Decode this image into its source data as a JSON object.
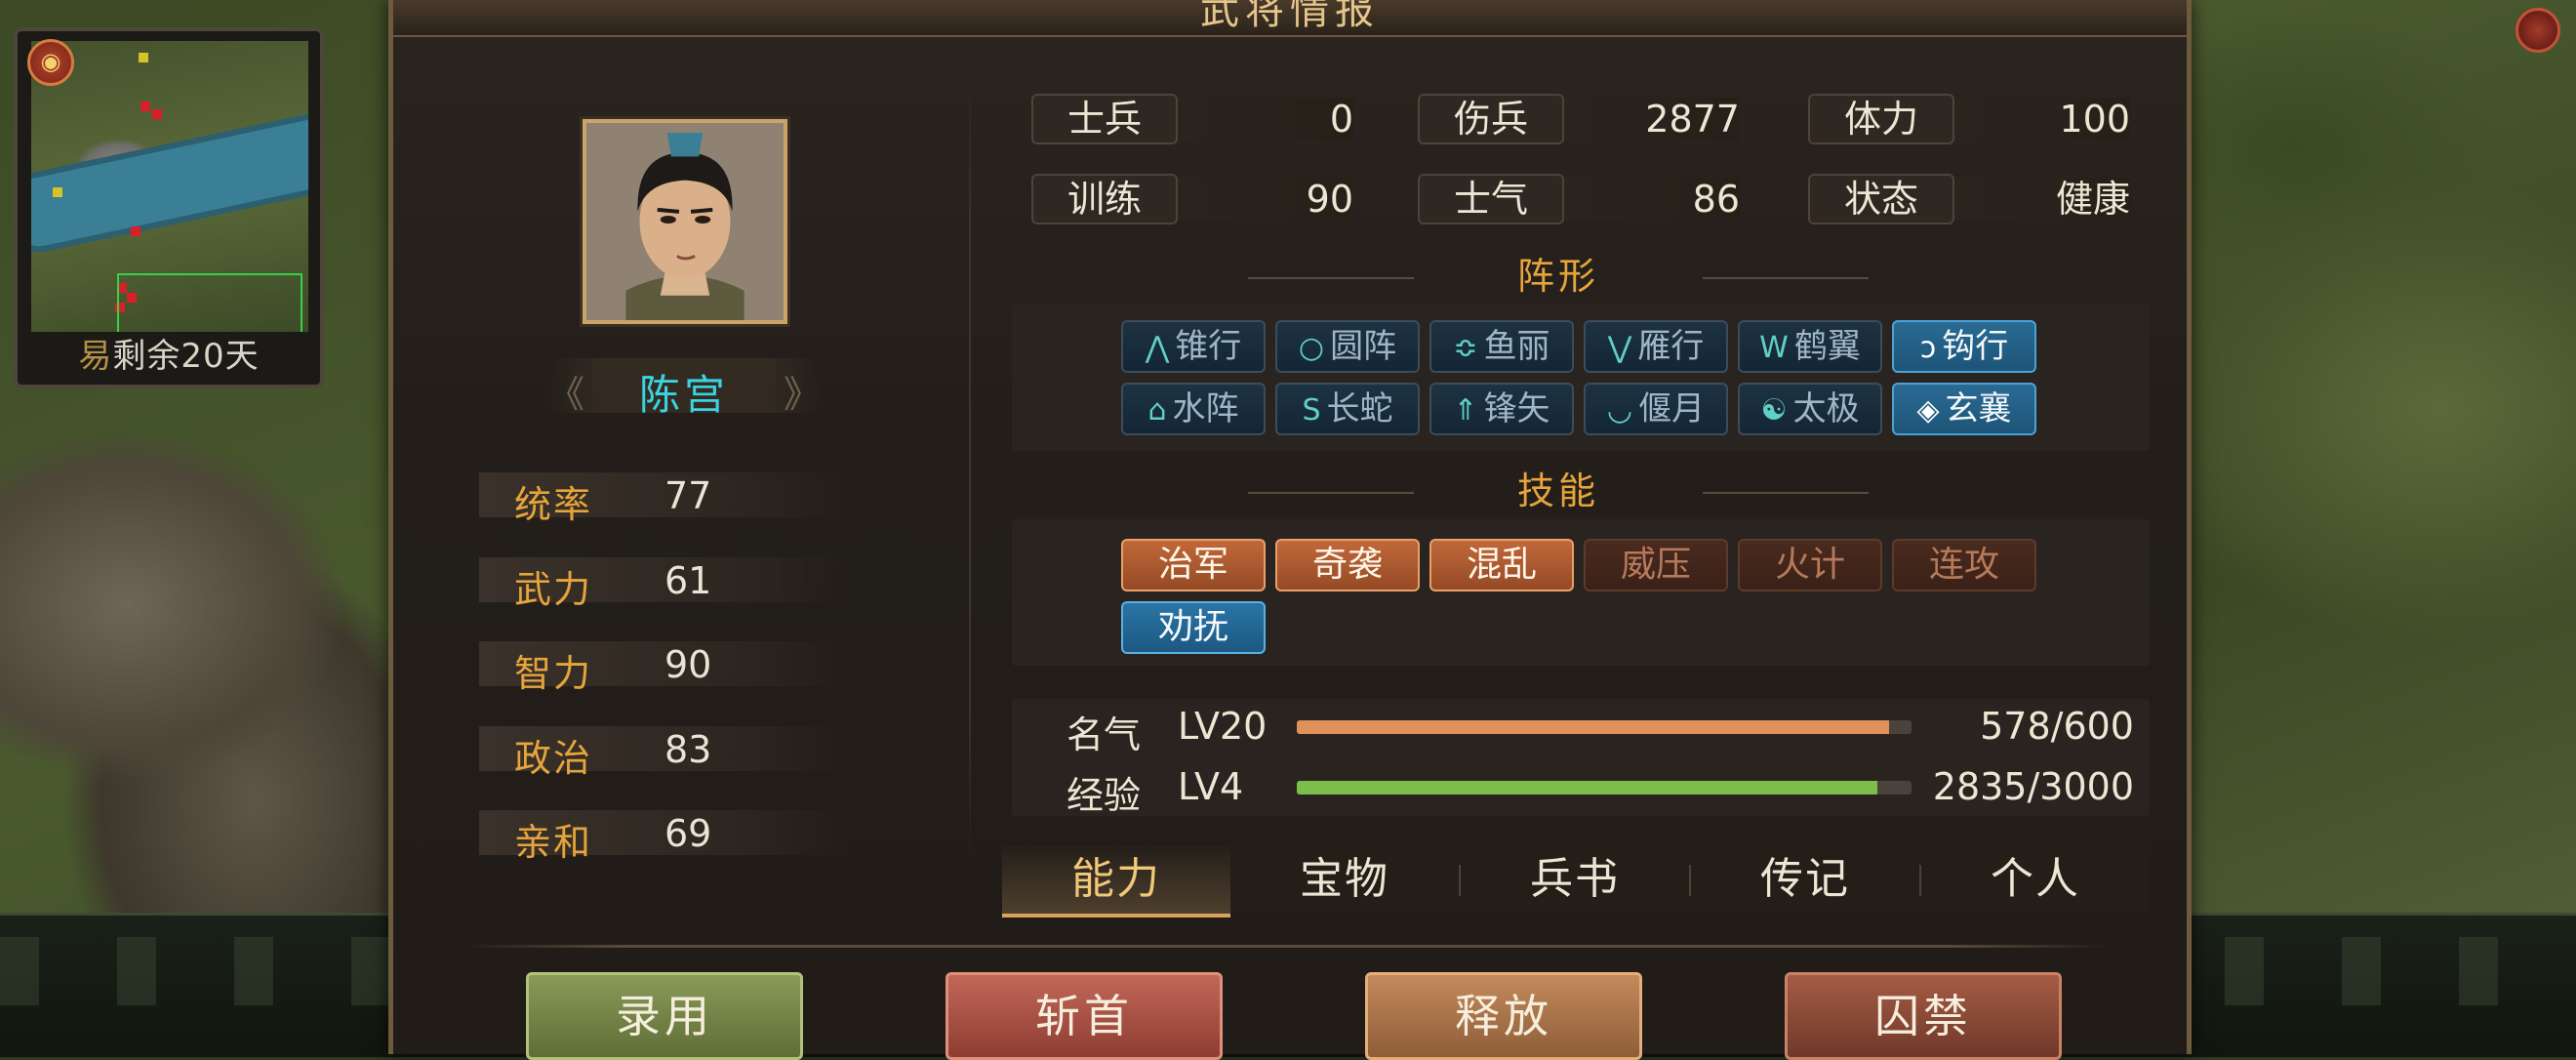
{
  "window": {
    "title": "武将情报"
  },
  "minimap": {
    "mark": "易",
    "caption": "剩余20天"
  },
  "general": {
    "name": "陈宫"
  },
  "attributes": [
    {
      "label": "统率",
      "value": "77"
    },
    {
      "label": "武力",
      "value": "61"
    },
    {
      "label": "智力",
      "value": "90"
    },
    {
      "label": "政治",
      "value": "83"
    },
    {
      "label": "亲和",
      "value": "69"
    }
  ],
  "stats": [
    {
      "label": "士兵",
      "value": "0"
    },
    {
      "label": "伤兵",
      "value": "2877"
    },
    {
      "label": "体力",
      "value": "100"
    },
    {
      "label": "训练",
      "value": "90"
    },
    {
      "label": "士气",
      "value": "86"
    },
    {
      "label": "状态",
      "value": "健康"
    }
  ],
  "formation": {
    "title": "阵形",
    "items": [
      {
        "label": "锥行",
        "icon": "⋀",
        "icon_name": "arrowhead-icon",
        "active": false
      },
      {
        "label": "圆阵",
        "icon": "○",
        "icon_name": "circle-icon",
        "active": false
      },
      {
        "label": "鱼丽",
        "icon": "≎",
        "icon_name": "fish-scale-icon",
        "active": false
      },
      {
        "label": "雁行",
        "icon": "⋁",
        "icon_name": "v-shape-icon",
        "active": false
      },
      {
        "label": "鹤翼",
        "icon": "W",
        "icon_name": "crane-wing-icon",
        "active": false
      },
      {
        "label": "钩行",
        "icon": "ↄ",
        "icon_name": "hook-icon",
        "active": true
      },
      {
        "label": "水阵",
        "icon": "⌂",
        "icon_name": "water-icon",
        "active": false
      },
      {
        "label": "长蛇",
        "icon": "S",
        "icon_name": "snake-icon",
        "active": false
      },
      {
        "label": "锋矢",
        "icon": "⇑",
        "icon_name": "arrow-up-icon",
        "active": false
      },
      {
        "label": "偃月",
        "icon": "◡",
        "icon_name": "crescent-icon",
        "active": false
      },
      {
        "label": "太极",
        "icon": "☯",
        "icon_name": "taiji-icon",
        "active": false
      },
      {
        "label": "玄襄",
        "icon": "◈",
        "icon_name": "diamond-icon",
        "active": true
      }
    ]
  },
  "skills": {
    "title": "技能",
    "items": [
      {
        "label": "治军",
        "state": "on"
      },
      {
        "label": "奇袭",
        "state": "on"
      },
      {
        "label": "混乱",
        "state": "on"
      },
      {
        "label": "威压",
        "state": "off"
      },
      {
        "label": "火计",
        "state": "off"
      },
      {
        "label": "连攻",
        "state": "off"
      },
      {
        "label": "劝抚",
        "state": "blue"
      }
    ]
  },
  "progress": [
    {
      "label": "名气",
      "level": "LV20",
      "text": "578/600",
      "fraction": 0.963,
      "color": "#e0915a"
    },
    {
      "label": "经验",
      "level": "LV4",
      "text": "2835/3000",
      "fraction": 0.945,
      "color": "#7bbf4a"
    }
  ],
  "tabs": [
    {
      "label": "能力",
      "active": true
    },
    {
      "label": "宝物",
      "active": false
    },
    {
      "label": "兵书",
      "active": false
    },
    {
      "label": "传记",
      "active": false
    },
    {
      "label": "个人",
      "active": false
    }
  ],
  "actions": [
    {
      "label": "录用",
      "style": "green"
    },
    {
      "label": "斩首",
      "style": "red"
    },
    {
      "label": "释放",
      "style": "tan"
    },
    {
      "label": "囚禁",
      "style": "brown"
    }
  ]
}
